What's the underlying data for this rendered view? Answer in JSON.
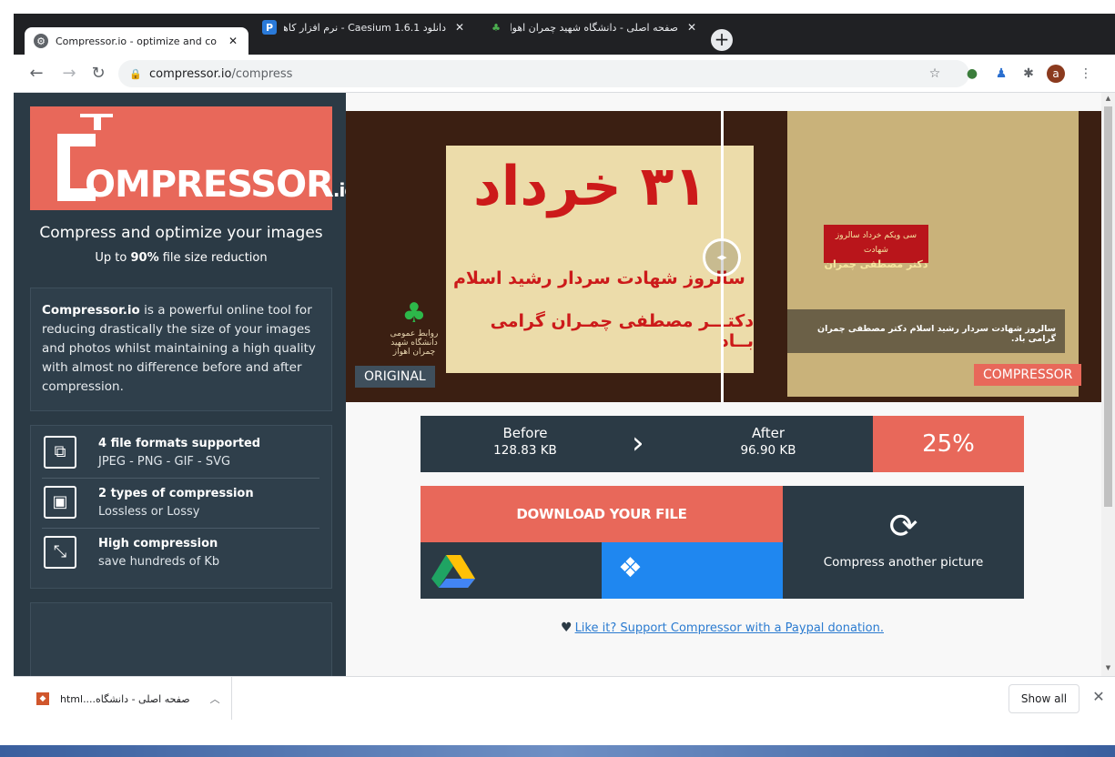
{
  "browser": {
    "tabs": [
      {
        "title": "Compressor.io - optimize and co",
        "icon": "compressor-favicon",
        "active": true
      },
      {
        "title": "دانلود Caesium 1.6.1 - نرم افزار کاهش",
        "icon": "p30-favicon",
        "active": false
      },
      {
        "title": "صفحه اصلی - دانشگاه شهید چمران اهواز",
        "icon": "university-favicon",
        "active": false
      }
    ],
    "url_host": "compressor.io",
    "url_path": "/compress"
  },
  "sidebar": {
    "logo_main": "OMPRESSOR",
    "logo_suffix": ".io",
    "tagline": "Compress and optimize your images",
    "subtag_prefix": "Up to ",
    "subtag_bold": "90%",
    "subtag_suffix": " file size reduction",
    "desc_bold": "Compressor.io",
    "desc_rest": " is a powerful online tool for reducing drastically the size of your images and photos whilst maintaining a high quality with almost no difference before and after compression.",
    "features": [
      {
        "icon": "copy-icon",
        "title": "4 file formats supported",
        "subtitle": "JPEG - PNG - GIF - SVG"
      },
      {
        "icon": "image-icon",
        "title": "2 types of compression",
        "subtitle": "Lossless or Lossy"
      },
      {
        "icon": "compress-arrows-icon",
        "title": "High compression",
        "subtitle": "save hundreds of Kb"
      }
    ]
  },
  "compare": {
    "label_original": "ORIGINAL",
    "label_compressed": "COMPRESSOR",
    "poster_big": "۳۱ خرداد",
    "poster_line1": "سالروز شهادت سردار رشید اسلام",
    "poster_line2": "دکتـــر مصطفی چمـران گرامی بــاد",
    "poster_logo": "روابط عمومی دانشگاه شهید چمران اهواز",
    "comp_title_line1": "سی ویکم خرداد سالروز شهادت",
    "comp_title_line2": "دکتر مصطفی چمران",
    "comp_overlay": "سالروز شهادت سردار رشید اسلام دکتر مصطفی چمران گرامی باد."
  },
  "stats": {
    "before_label": "Before",
    "before_value": "128.83 KB",
    "after_label": "After",
    "after_value": "96.90 KB",
    "percent": "25%"
  },
  "actions": {
    "download_label": "DOWNLOAD YOUR FILE",
    "compress_another": "Compress another picture"
  },
  "support": {
    "text": "Like it? Support Compressor with a Paypal donation."
  },
  "download_bar": {
    "file_name": "صفحه اصلی - دانشگاه....html",
    "show_all": "Show all"
  },
  "colors": {
    "accent": "#e8685a",
    "dark": "#2b3a45",
    "dropbox": "#1f87f0"
  }
}
